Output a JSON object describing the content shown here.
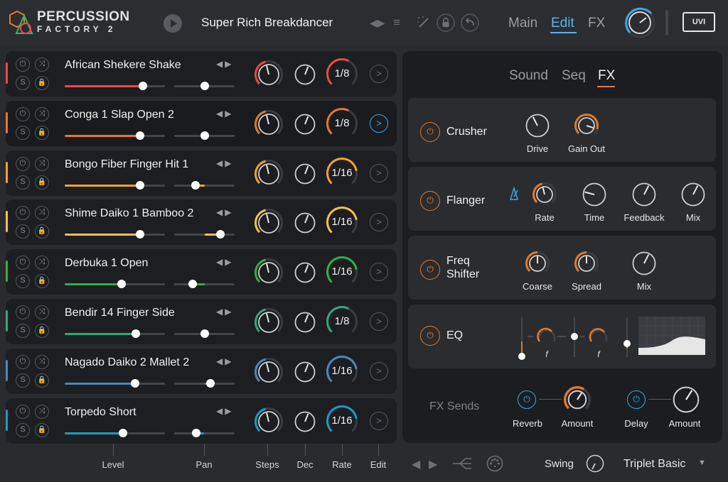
{
  "app": {
    "logo_line1": "PERCUSSION",
    "logo_line2": "FACTORY 2",
    "preset_name": "Super Rich Breakdancer",
    "brand": "UVI",
    "main_tabs": [
      {
        "label": "Main",
        "active": false
      },
      {
        "label": "Edit",
        "active": true
      },
      {
        "label": "FX",
        "active": false
      }
    ]
  },
  "tracks": [
    {
      "name": "African Shekere Shake",
      "color": "#e84a4a",
      "level": 0.78,
      "pan": 0.5,
      "steps": "1/8",
      "steps_fill": 0.6,
      "selected": false
    },
    {
      "name": "Conga 1 Slap Open 2",
      "color": "#e07a2b",
      "level": 0.75,
      "pan": 0.5,
      "steps": "1/8",
      "steps_fill": 0.6,
      "selected": true
    },
    {
      "name": "Bongo Fiber Finger Hit 1",
      "color": "#f0a030",
      "level": 0.75,
      "pan": 0.35,
      "steps": "1/16",
      "steps_fill": 0.8,
      "selected": false
    },
    {
      "name": "Shime Daiko 1 Bamboo 2",
      "color": "#f2c14a",
      "level": 0.75,
      "pan": 0.76,
      "steps": "1/16",
      "steps_fill": 0.8,
      "selected": false
    },
    {
      "name": "Derbuka 1 Open",
      "color": "#2fb04a",
      "level": 0.57,
      "pan": 0.3,
      "steps": "1/16",
      "steps_fill": 0.8,
      "selected": false
    },
    {
      "name": "Bendir 14 Finger Side",
      "color": "#2fa878",
      "level": 0.71,
      "pan": 0.5,
      "steps": "1/8",
      "steps_fill": 0.6,
      "selected": false
    },
    {
      "name": "Nagado Daiko 2 Mallet 2",
      "color": "#4f86b8",
      "level": 0.7,
      "pan": 0.6,
      "steps": "1/16",
      "steps_fill": 0.8,
      "selected": false
    },
    {
      "name": "Torpedo Short",
      "color": "#1a9cc0",
      "level": 0.58,
      "pan": 0.37,
      "steps": "1/16",
      "steps_fill": 0.8,
      "selected": false
    }
  ],
  "fx": {
    "sub_tabs": [
      {
        "label": "Sound",
        "active": false
      },
      {
        "label": "Seq",
        "active": false
      },
      {
        "label": "FX",
        "active": true
      }
    ],
    "crusher": {
      "name": "Crusher",
      "knobs": [
        "Drive",
        "Gain Out"
      ]
    },
    "flanger": {
      "name": "Flanger",
      "knobs": [
        "Rate",
        "Time",
        "Feedback",
        "Mix"
      ]
    },
    "freq_shifter": {
      "name_line1": "Freq",
      "name_line2": "Shifter",
      "knobs": [
        "Coarse",
        "Spread",
        "Mix"
      ]
    },
    "eq": {
      "name": "EQ",
      "freq_symbol": "f"
    },
    "sends": {
      "title": "FX Sends",
      "labels": [
        "Reverb",
        "Amount",
        "Delay",
        "Amount"
      ]
    }
  },
  "footer": {
    "columns": [
      "Level",
      "Pan",
      "Steps",
      "Dec",
      "Rate",
      "Edit"
    ],
    "swing_label": "Swing",
    "groove_preset": "Triplet Basic"
  },
  "colors": {
    "accent": "#e07a2b",
    "highlight": "#3ba8e0",
    "panel": "#1d1e21"
  }
}
